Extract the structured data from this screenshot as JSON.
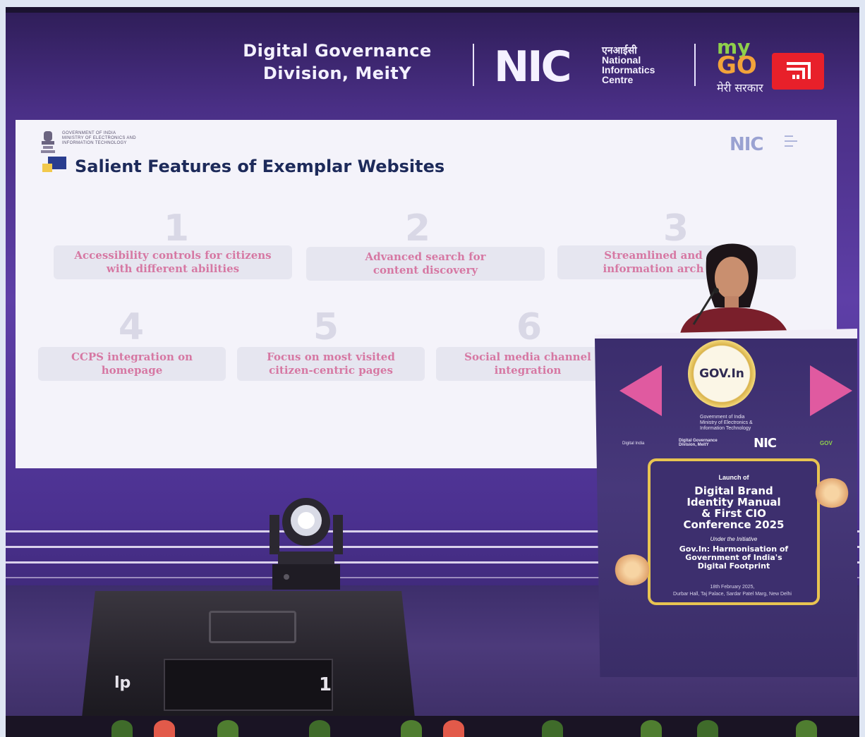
{
  "header": {
    "division_line1": "Digital Governance",
    "division_line2": "Division, MeitY",
    "nic_logo": "NIC",
    "nic_hindi": "एनआईसी",
    "nic_line1": "National",
    "nic_line2": "Informatics",
    "nic_line3": "Centre",
    "mygov_my": "my",
    "mygov_go": "GO",
    "mygov_hindi": "मेरी सरकार"
  },
  "slide": {
    "gov_line1": "GOVERNMENT OF INDIA",
    "gov_line2": "MINISTRY OF ELECTRONICS AND",
    "gov_line3": "INFORMATION TECHNOLOGY",
    "nic_logo": "NIC",
    "title": "Salient Features of Exemplar Websites",
    "features": [
      {
        "num": "1",
        "text": "Accessibility controls for citizens with different abilities"
      },
      {
        "num": "2",
        "text": "Advanced search for content discovery"
      },
      {
        "num": "3",
        "text": "Streamlined and information arch"
      },
      {
        "num": "4",
        "text": "CCPS integration on homepage"
      },
      {
        "num": "5",
        "text": "Focus on most visited citizen-centric pages"
      },
      {
        "num": "6",
        "text": "Social media channel integration"
      }
    ]
  },
  "podium": {
    "govin": "GOV.In",
    "ministry_line1": "Government of India",
    "ministry_line2": "Ministry of Electronics &",
    "ministry_line3": "Information Technology",
    "digital_india": "Digital India",
    "dgd_line1": "Digital Governance",
    "dgd_line2": "Division, MeitY",
    "nic": "NIC",
    "mygov": "GOV",
    "launch_of": "Launch of",
    "launch_title_1": "Digital Brand",
    "launch_title_2": "Identity Manual",
    "launch_title_3": "& First CIO",
    "launch_title_4": "Conference 2025",
    "under": "Under the Initiative",
    "sub_1": "Gov.In: Harmonisation of",
    "sub_2": "Government of India's",
    "sub_3": "Digital Footprint",
    "date": "18th February 2025,",
    "venue": "Durbar Hall, Taj Palace, Sardar Patel Marg, New Delhi"
  },
  "speaker_box": {
    "logo": "lp",
    "channel": "1"
  },
  "colors": {
    "stage_purple": "#5e3fa7",
    "badge_red": "#e8202a",
    "feature_pink": "#d678a3",
    "gold": "#e8c451"
  }
}
